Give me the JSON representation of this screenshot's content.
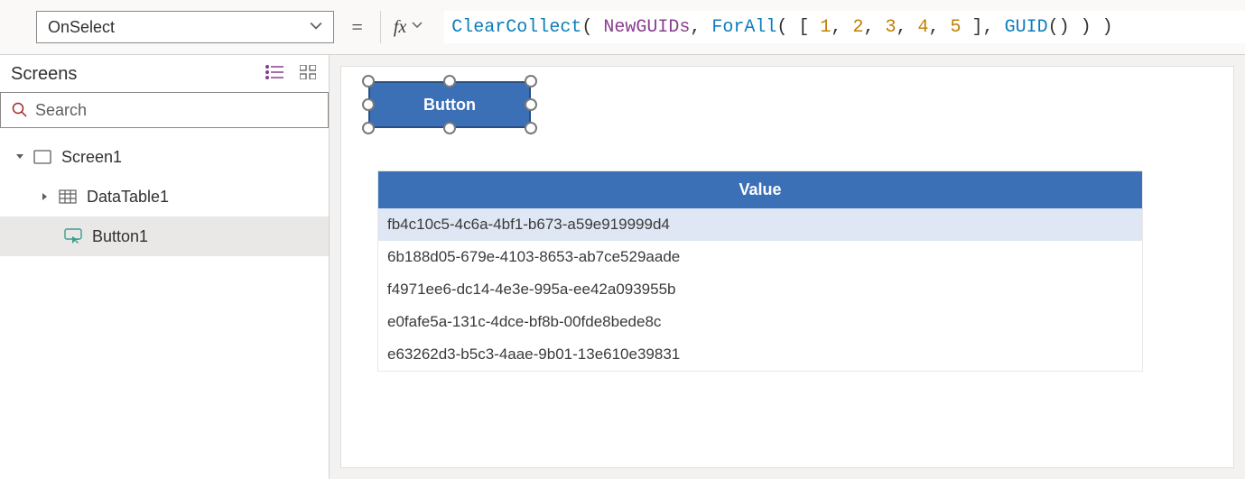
{
  "formulaBar": {
    "property": "OnSelect",
    "formula": {
      "tokens": [
        {
          "t": "fn",
          "v": "ClearCollect"
        },
        {
          "t": "punc",
          "v": "( "
        },
        {
          "t": "id",
          "v": "NewGUIDs"
        },
        {
          "t": "punc",
          "v": ", "
        },
        {
          "t": "fn",
          "v": "ForAll"
        },
        {
          "t": "punc",
          "v": "( [ "
        },
        {
          "t": "num",
          "v": "1"
        },
        {
          "t": "punc",
          "v": ", "
        },
        {
          "t": "num",
          "v": "2"
        },
        {
          "t": "punc",
          "v": ", "
        },
        {
          "t": "num",
          "v": "3"
        },
        {
          "t": "punc",
          "v": ", "
        },
        {
          "t": "num",
          "v": "4"
        },
        {
          "t": "punc",
          "v": ", "
        },
        {
          "t": "num",
          "v": "5"
        },
        {
          "t": "punc",
          "v": " ], "
        },
        {
          "t": "fn",
          "v": "GUID"
        },
        {
          "t": "punc",
          "v": "() ) )"
        }
      ]
    }
  },
  "leftPanel": {
    "title": "Screens",
    "searchPlaceholder": "Search",
    "tree": {
      "screen": "Screen1",
      "children": [
        {
          "name": "DataTable1",
          "type": "datatable",
          "selected": false
        },
        {
          "name": "Button1",
          "type": "button",
          "selected": true
        }
      ]
    }
  },
  "canvas": {
    "buttonLabel": "Button",
    "dataTable": {
      "header": "Value",
      "rows": [
        "fb4c10c5-4c6a-4bf1-b673-a59e919999d4",
        "6b188d05-679e-4103-8653-ab7ce529aade",
        "f4971ee6-dc14-4e3e-995a-ee42a093955b",
        "e0fafe5a-131c-4dce-bf8b-00fde8bede8c",
        "e63262d3-b5c3-4aae-9b01-13e610e39831"
      ],
      "selectedIndex": 0
    }
  }
}
